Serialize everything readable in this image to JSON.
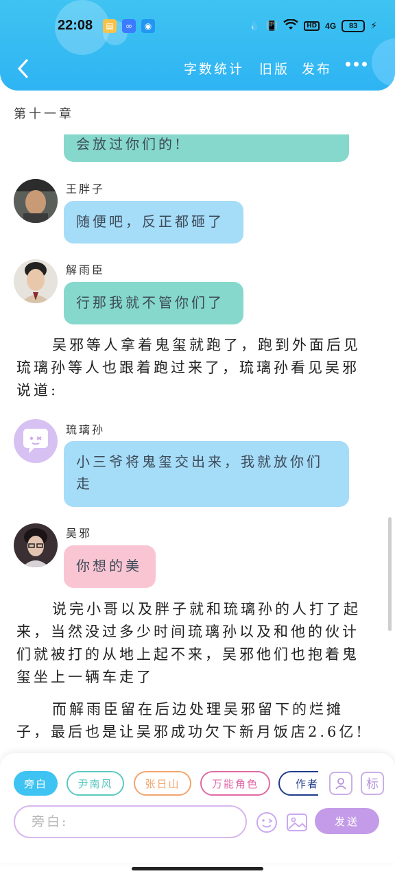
{
  "status_bar": {
    "time": "22:08",
    "network": "4G",
    "battery": "83"
  },
  "nav": {
    "word_count": "字数统计",
    "old_version": "旧版",
    "publish": "发布"
  },
  "chapter_title": "第十一章",
  "messages": [
    {
      "type": "bubble",
      "color": "teal",
      "text": "会放过你们的!"
    },
    {
      "type": "character",
      "name": "王胖子",
      "color": "blue",
      "text": "随便吧，反正都砸了"
    },
    {
      "type": "character",
      "name": "解雨臣",
      "color": "teal",
      "text": "行那我就不管你们了"
    },
    {
      "type": "narration",
      "text": "吴邪等人拿着鬼玺就跑了，跑到外面后见琉璃孙等人也跟着跑过来了，琉璃孙看见吴邪说道:"
    },
    {
      "type": "character",
      "name": "琉璃孙",
      "color": "blue",
      "text": "小三爷将鬼玺交出来，我就放你们走"
    },
    {
      "type": "character",
      "name": "吴邪",
      "color": "pink",
      "text": "你想的美"
    },
    {
      "type": "narration",
      "text": "说完小哥以及胖子就和琉璃孙的人打了起来，当然没过多少时间琉璃孙以及和他的伙计们就被打的从地上起不来，吴邪他们也抱着鬼玺坐上一辆车走了"
    },
    {
      "type": "narration",
      "text": "而解雨臣留在后边处理吴邪留下的烂摊子，最后也是让吴邪成功欠下新月饭店2.6亿!"
    }
  ],
  "roles": [
    {
      "label": "旁白",
      "color": "#3ec3f2",
      "selected": true
    },
    {
      "label": "尹南风",
      "color": "#5cc9c0",
      "selected": false
    },
    {
      "label": "张日山",
      "color": "#f2a56e",
      "selected": false
    },
    {
      "label": "万能角色",
      "color": "#e06aa6",
      "selected": false
    },
    {
      "label": "作者",
      "color": "#1f3b8a",
      "selected": false
    }
  ],
  "role_icons": [
    "person-card-icon",
    "tag-icon"
  ],
  "tag_icon_text": "标",
  "input": {
    "placeholder": "旁白:"
  },
  "send_label": "发送",
  "colors": {
    "header": "#3fc3f2",
    "teal_bubble": "#86d8cc",
    "blue_bubble": "#a5dcf8",
    "pink_bubble": "#f9c5d3",
    "send": "#c49be8"
  }
}
